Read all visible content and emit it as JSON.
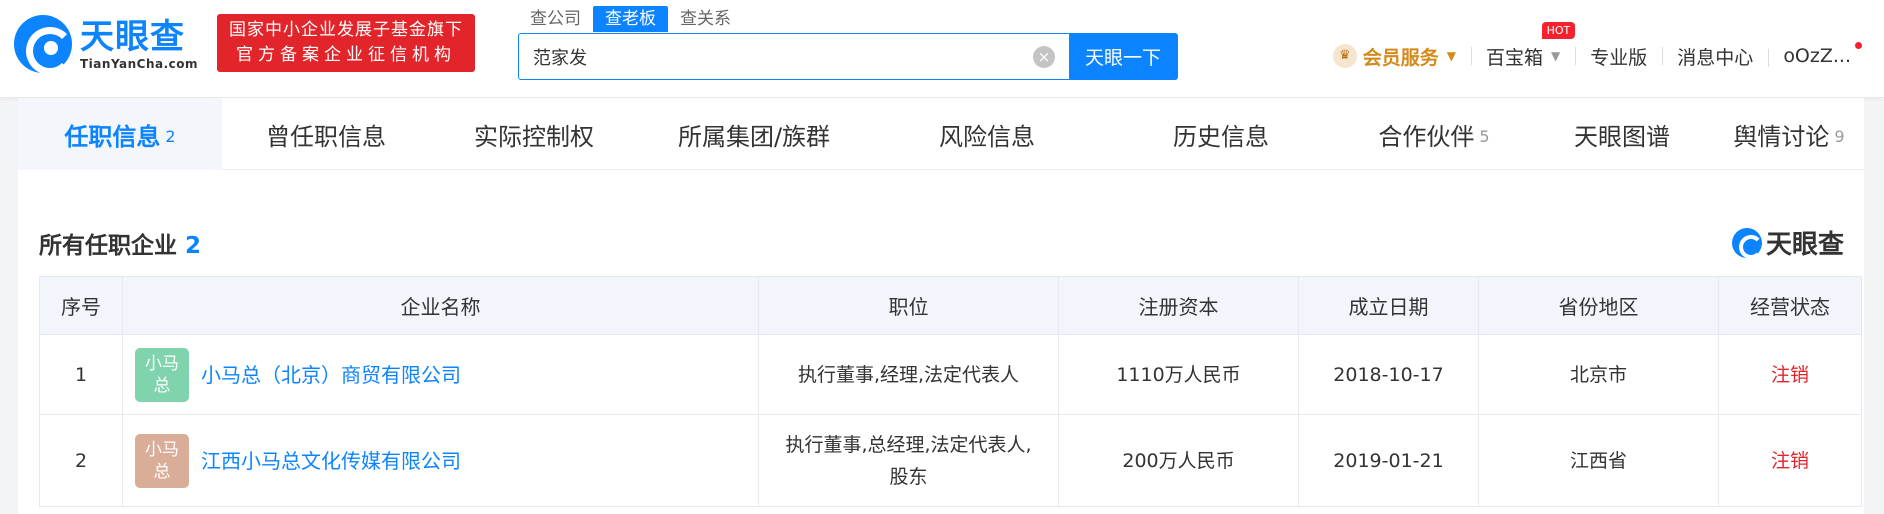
{
  "header": {
    "logo_cn": "天眼查",
    "logo_en": "TianYanCha.com",
    "gov_badge_line1": "国家中小企业发展子基金旗下",
    "gov_badge_line2": "官方备案企业征信机构",
    "search_tabs": [
      "查公司",
      "查老板",
      "查关系"
    ],
    "search_value": "范家发",
    "search_button": "天眼一下",
    "clear_icon": "×",
    "nav": {
      "vip_label": "会员服务",
      "vip_icon": "♛",
      "baibaoxiang": "百宝箱",
      "hot_badge": "HOT",
      "pro": "专业版",
      "messages": "消息中心",
      "user": "oOzZ...",
      "caret": "▼"
    }
  },
  "tabs": [
    {
      "label": "任职信息",
      "count": "2"
    },
    {
      "label": "曾任职信息",
      "count": ""
    },
    {
      "label": "实际控制权",
      "count": ""
    },
    {
      "label": "所属集团/族群",
      "count": ""
    },
    {
      "label": "风险信息",
      "count": ""
    },
    {
      "label": "历史信息",
      "count": ""
    },
    {
      "label": "合作伙伴",
      "count": "5"
    },
    {
      "label": "天眼图谱",
      "count": ""
    },
    {
      "label": "舆情讨论",
      "count": "9"
    }
  ],
  "section": {
    "title": "所有任职企业",
    "count": "2",
    "watermark": "天眼查"
  },
  "table": {
    "columns": [
      "序号",
      "企业名称",
      "职位",
      "注册资本",
      "成立日期",
      "省份地区",
      "经营状态"
    ],
    "rows": [
      {
        "index": "1",
        "avatar_line1": "小马",
        "avatar_line2": "总",
        "avatar_color": "#7fd3ad",
        "company": "小马总（北京）商贸有限公司",
        "position": "执行董事,经理,法定代表人",
        "capital": "1110万人民币",
        "founded": "2018-10-17",
        "region": "北京市",
        "status": "注销"
      },
      {
        "index": "2",
        "avatar_line1": "小马",
        "avatar_line2": "总",
        "avatar_color": "#d9ad97",
        "company": "江西小马总文化传媒有限公司",
        "position_line1": "执行董事,总经理,法定代表人,",
        "position_line2": "股东",
        "capital": "200万人民币",
        "founded": "2019-01-21",
        "region": "江西省",
        "status": "注销"
      }
    ]
  },
  "colors": {
    "brand_blue": "#0c84ff",
    "badge_red": "#e2252b",
    "vip_gold": "#d48a1b"
  }
}
